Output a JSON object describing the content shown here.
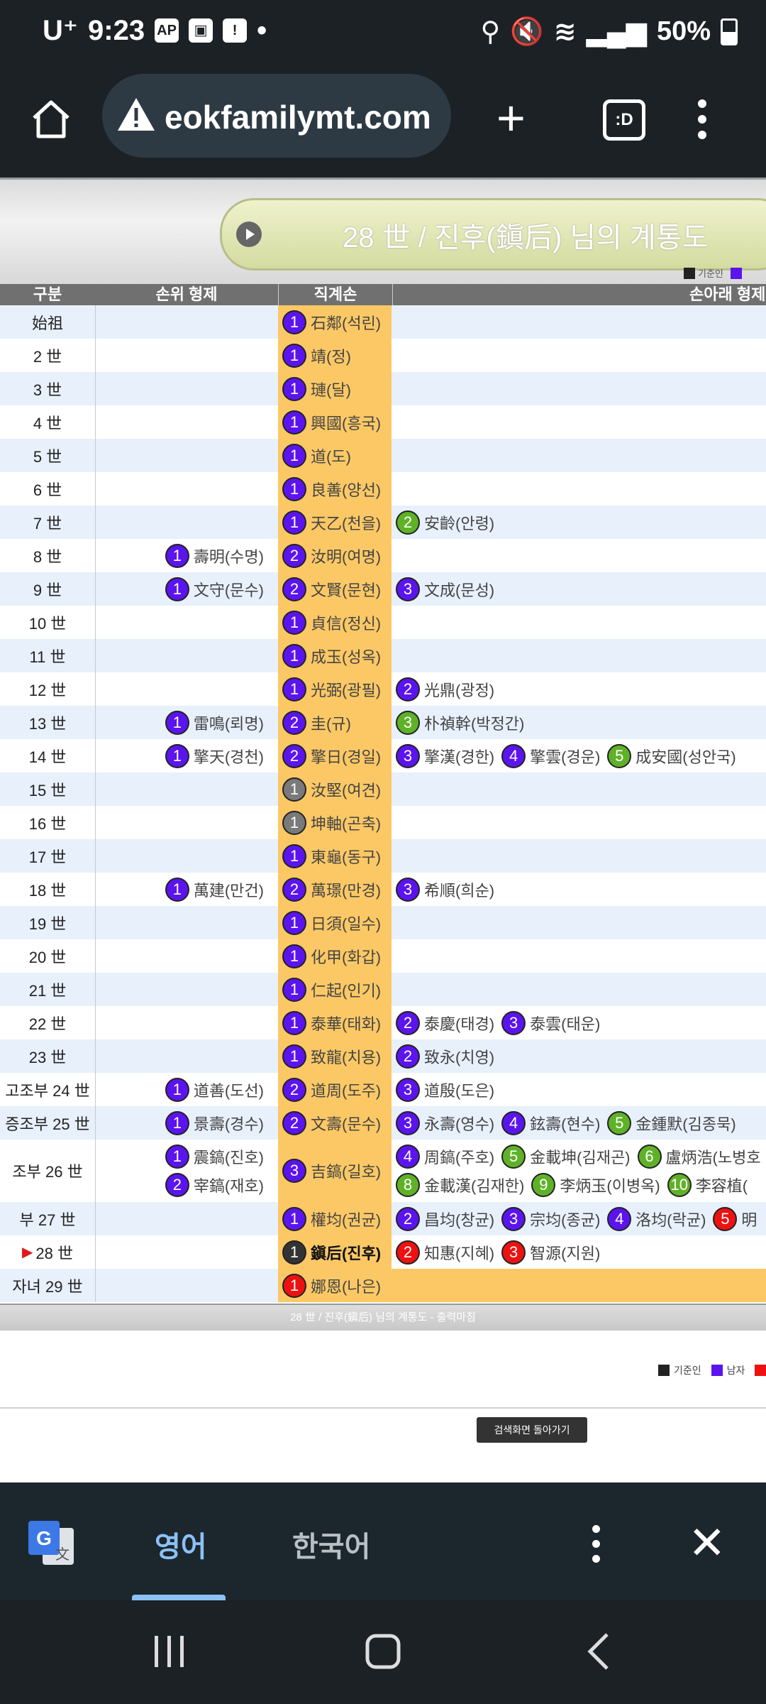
{
  "status": {
    "carrier": "U⁺",
    "time": "9:23",
    "battery": "50%"
  },
  "browser": {
    "url": "eokfamilymt.com",
    "tabs_label": ":D"
  },
  "page": {
    "title": "28 世 / 진후(鎭后) 님의 계통도",
    "legend_top": "기준인",
    "headers": {
      "gen": "구분",
      "elder": "손위 형제",
      "direct": "직계손",
      "younger": "손아래 형제"
    },
    "footer_title": "28 世 / 진후(鎭后) 님의 계통도 - 출력마침",
    "legend": [
      "기준인",
      "남자"
    ],
    "back_button": "검색화면 돌아가기"
  },
  "table": [
    {
      "gen": "始祖",
      "elder": [],
      "direct": [
        {
          "n": "1",
          "c": "p",
          "t": "石鄰(석린)"
        }
      ],
      "younger": []
    },
    {
      "gen": "2 世",
      "elder": [],
      "direct": [
        {
          "n": "1",
          "c": "p",
          "t": "靖(정)"
        }
      ],
      "younger": []
    },
    {
      "gen": "3 世",
      "elder": [],
      "direct": [
        {
          "n": "1",
          "c": "p",
          "t": "璉(달)"
        }
      ],
      "younger": []
    },
    {
      "gen": "4 世",
      "elder": [],
      "direct": [
        {
          "n": "1",
          "c": "p",
          "t": "興國(흥국)"
        }
      ],
      "younger": []
    },
    {
      "gen": "5 世",
      "elder": [],
      "direct": [
        {
          "n": "1",
          "c": "p",
          "t": "道(도)"
        }
      ],
      "younger": []
    },
    {
      "gen": "6 世",
      "elder": [],
      "direct": [
        {
          "n": "1",
          "c": "p",
          "t": "良善(양선)"
        }
      ],
      "younger": []
    },
    {
      "gen": "7 世",
      "elder": [],
      "direct": [
        {
          "n": "1",
          "c": "p",
          "t": "天乙(천을)"
        }
      ],
      "younger": [
        {
          "n": "2",
          "c": "g",
          "t": "安齡(안령)"
        }
      ]
    },
    {
      "gen": "8 世",
      "elder": [
        {
          "n": "1",
          "c": "p",
          "t": "壽明(수명)"
        }
      ],
      "direct": [
        {
          "n": "2",
          "c": "p",
          "t": "汝明(여명)"
        }
      ],
      "younger": []
    },
    {
      "gen": "9 世",
      "elder": [
        {
          "n": "1",
          "c": "p",
          "t": "文守(문수)"
        }
      ],
      "direct": [
        {
          "n": "2",
          "c": "p",
          "t": "文賢(문현)"
        }
      ],
      "younger": [
        {
          "n": "3",
          "c": "p",
          "t": "文成(문성)"
        }
      ]
    },
    {
      "gen": "10 世",
      "elder": [],
      "direct": [
        {
          "n": "1",
          "c": "p",
          "t": "貞信(정신)"
        }
      ],
      "younger": []
    },
    {
      "gen": "11 世",
      "elder": [],
      "direct": [
        {
          "n": "1",
          "c": "p",
          "t": "成玉(성옥)"
        }
      ],
      "younger": []
    },
    {
      "gen": "12 世",
      "elder": [],
      "direct": [
        {
          "n": "1",
          "c": "p",
          "t": "光弼(광필)"
        }
      ],
      "younger": [
        {
          "n": "2",
          "c": "p",
          "t": "光鼎(광정)"
        }
      ]
    },
    {
      "gen": "13 世",
      "elder": [
        {
          "n": "1",
          "c": "p",
          "t": "雷鳴(뢰명)"
        }
      ],
      "direct": [
        {
          "n": "2",
          "c": "p",
          "t": "圭(규)"
        }
      ],
      "younger": [
        {
          "n": "3",
          "c": "g",
          "t": "朴禎幹(박정간)"
        }
      ]
    },
    {
      "gen": "14 世",
      "elder": [
        {
          "n": "1",
          "c": "p",
          "t": "擎天(경천)"
        }
      ],
      "direct": [
        {
          "n": "2",
          "c": "p",
          "t": "擎日(경일)"
        }
      ],
      "younger": [
        {
          "n": "3",
          "c": "p",
          "t": "擎漢(경한)"
        },
        {
          "n": "4",
          "c": "p",
          "t": "擎雲(경운)"
        },
        {
          "n": "5",
          "c": "g",
          "t": "成安國(성안국)"
        }
      ]
    },
    {
      "gen": "15 世",
      "elder": [],
      "direct": [
        {
          "n": "1",
          "c": "gr",
          "t": "汝堅(여견)"
        }
      ],
      "younger": []
    },
    {
      "gen": "16 世",
      "elder": [],
      "direct": [
        {
          "n": "1",
          "c": "gr",
          "t": "坤軸(곤축)"
        }
      ],
      "younger": []
    },
    {
      "gen": "17 世",
      "elder": [],
      "direct": [
        {
          "n": "1",
          "c": "p",
          "t": "東龜(동구)"
        }
      ],
      "younger": []
    },
    {
      "gen": "18 世",
      "elder": [
        {
          "n": "1",
          "c": "p",
          "t": "萬建(만건)"
        }
      ],
      "direct": [
        {
          "n": "2",
          "c": "p",
          "t": "萬璟(만경)"
        }
      ],
      "younger": [
        {
          "n": "3",
          "c": "p",
          "t": "希順(희순)"
        }
      ]
    },
    {
      "gen": "19 世",
      "elder": [],
      "direct": [
        {
          "n": "1",
          "c": "p",
          "t": "日須(일수)"
        }
      ],
      "younger": []
    },
    {
      "gen": "20 世",
      "elder": [],
      "direct": [
        {
          "n": "1",
          "c": "p",
          "t": "化甲(화갑)"
        }
      ],
      "younger": []
    },
    {
      "gen": "21 世",
      "elder": [],
      "direct": [
        {
          "n": "1",
          "c": "p",
          "t": "仁起(인기)"
        }
      ],
      "younger": []
    },
    {
      "gen": "22 世",
      "elder": [],
      "direct": [
        {
          "n": "1",
          "c": "p",
          "t": "泰華(태화)"
        }
      ],
      "younger": [
        {
          "n": "2",
          "c": "p",
          "t": "泰慶(태경)"
        },
        {
          "n": "3",
          "c": "p",
          "t": "泰雲(태운)"
        }
      ]
    },
    {
      "gen": "23 世",
      "elder": [],
      "direct": [
        {
          "n": "1",
          "c": "p",
          "t": "致龍(치용)"
        }
      ],
      "younger": [
        {
          "n": "2",
          "c": "p",
          "t": "致永(치영)"
        }
      ]
    },
    {
      "gen": "고조부 24 世",
      "elder": [
        {
          "n": "1",
          "c": "p",
          "t": "道善(도선)"
        }
      ],
      "direct": [
        {
          "n": "2",
          "c": "p",
          "t": "道周(도주)"
        }
      ],
      "younger": [
        {
          "n": "3",
          "c": "p",
          "t": "道殷(도은)"
        }
      ]
    },
    {
      "gen": "증조부 25 世",
      "elder": [
        {
          "n": "1",
          "c": "p",
          "t": "景壽(경수)"
        }
      ],
      "direct": [
        {
          "n": "2",
          "c": "p",
          "t": "文壽(문수)"
        }
      ],
      "younger": [
        {
          "n": "3",
          "c": "p",
          "t": "永壽(영수)"
        },
        {
          "n": "4",
          "c": "p",
          "t": "鉉壽(현수)"
        },
        {
          "n": "5",
          "c": "g",
          "t": "金鍾默(김종묵)"
        }
      ]
    },
    {
      "gen": "조부 26 世",
      "elder": [
        {
          "n": "1",
          "c": "p",
          "t": "震鎬(진호)"
        },
        {
          "n": "2",
          "c": "p",
          "t": "宰鎬(재호)"
        }
      ],
      "direct": [
        {
          "n": "3",
          "c": "p",
          "t": "吉鎬(길호)"
        }
      ],
      "younger": [
        {
          "n": "4",
          "c": "p",
          "t": "周鎬(주호)"
        },
        {
          "n": "5",
          "c": "g",
          "t": "金載坤(김재곤)"
        },
        {
          "n": "6",
          "c": "g",
          "t": "盧炳浩(노병호"
        },
        {
          "n": "8",
          "c": "g",
          "t": "金載漢(김재한)"
        },
        {
          "n": "9",
          "c": "g",
          "t": "李炳玉(이병옥)"
        },
        {
          "n": "10",
          "c": "g",
          "t": "李容植("
        }
      ]
    },
    {
      "gen": "부 27 世",
      "elder": [],
      "direct": [
        {
          "n": "1",
          "c": "p",
          "t": "權均(권균)"
        }
      ],
      "younger": [
        {
          "n": "2",
          "c": "p",
          "t": "昌均(창균)"
        },
        {
          "n": "3",
          "c": "p",
          "t": "宗均(종균)"
        },
        {
          "n": "4",
          "c": "p",
          "t": "洛均(락균)"
        },
        {
          "n": "5",
          "c": "r",
          "t": "明"
        }
      ]
    },
    {
      "gen": "28 世",
      "elder": [],
      "direct": [
        {
          "n": "1",
          "c": "k",
          "t": "鎭后(진후)"
        }
      ],
      "younger": [
        {
          "n": "2",
          "c": "r",
          "t": "知惠(지혜)"
        },
        {
          "n": "3",
          "c": "r",
          "t": "智源(지원)"
        }
      ]
    },
    {
      "gen": "자녀 29 世",
      "elder": [],
      "direct": [
        {
          "n": "1",
          "c": "r",
          "t": "娜恩(나은)"
        }
      ],
      "younger": []
    }
  ],
  "translate": {
    "lang_active": "영어",
    "lang_other": "한국어"
  }
}
